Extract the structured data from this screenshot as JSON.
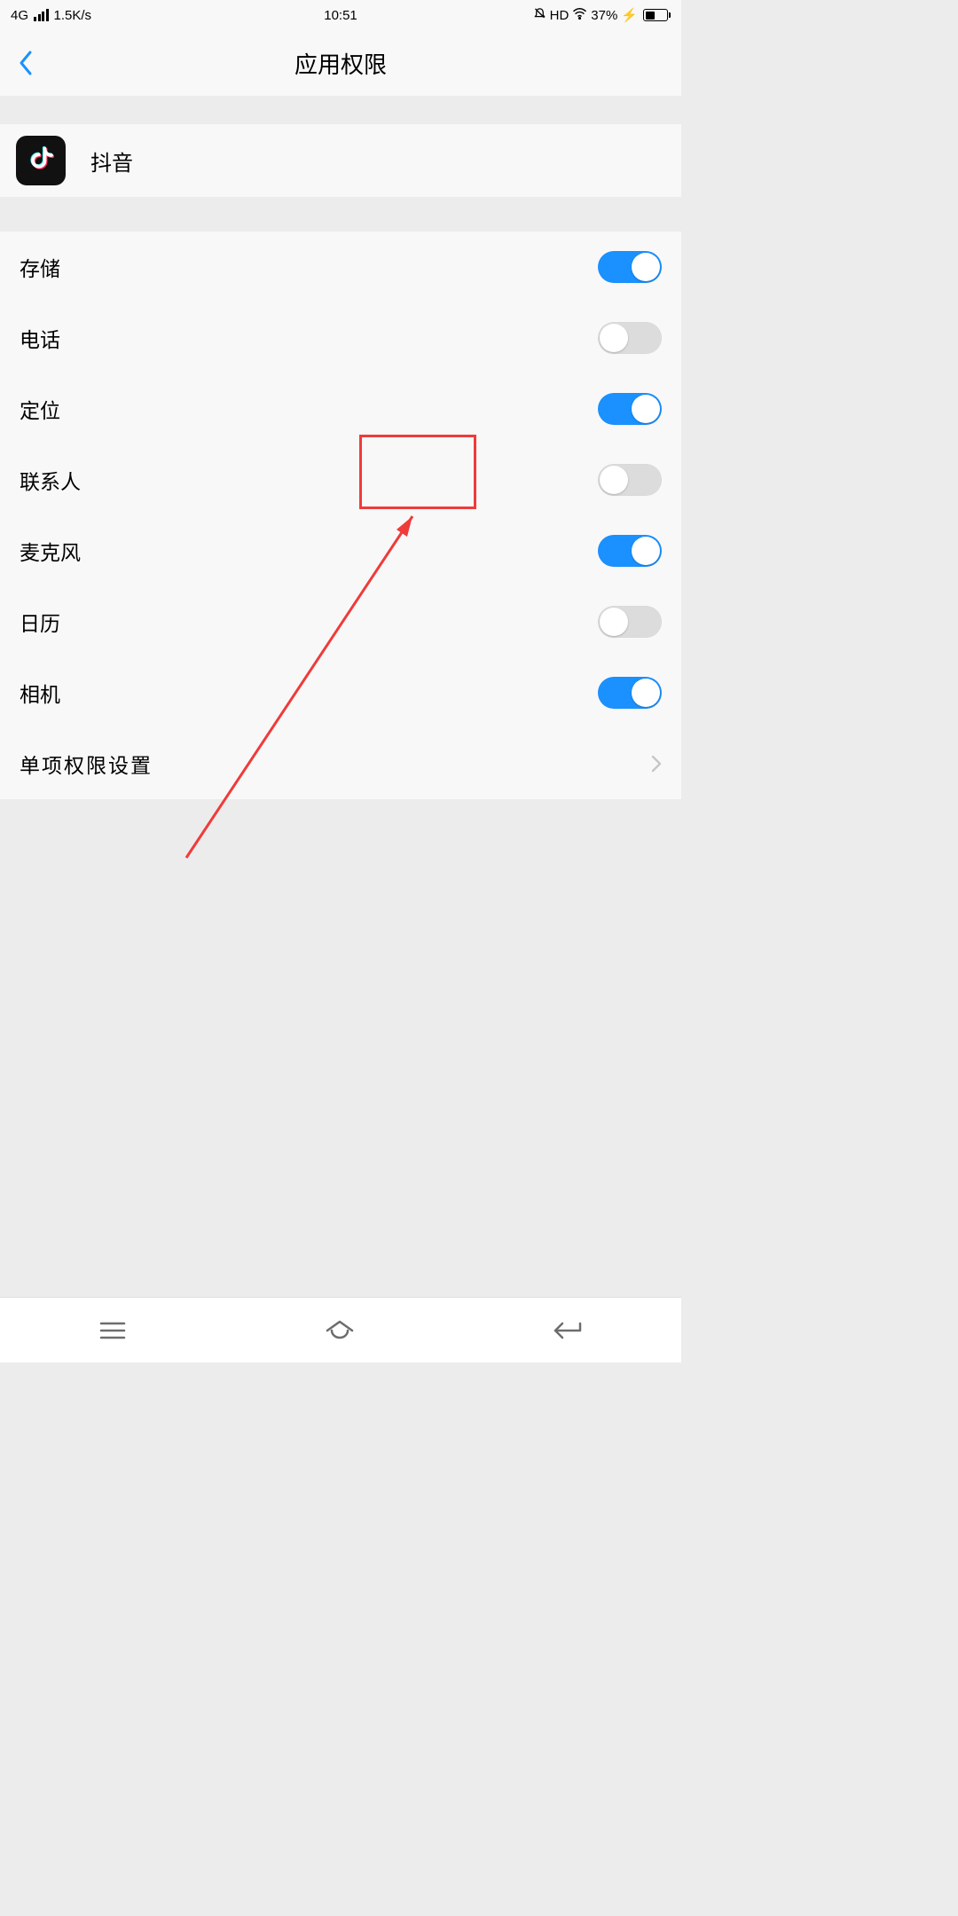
{
  "status": {
    "net": "4G",
    "speed": "1.5K/s",
    "time": "10:51",
    "hd": "HD",
    "battery_pct": "37%"
  },
  "header": {
    "title": "应用权限"
  },
  "app": {
    "name": "抖音"
  },
  "perms": [
    {
      "label": "存储",
      "on": true
    },
    {
      "label": "电话",
      "on": false
    },
    {
      "label": "定位",
      "on": true
    },
    {
      "label": "联系人",
      "on": false
    },
    {
      "label": "麦克风",
      "on": true
    },
    {
      "label": "日历",
      "on": false
    },
    {
      "label": "相机",
      "on": true
    }
  ],
  "more": {
    "label": "单项权限设置"
  },
  "annotation": {
    "highlight_row_index": 3
  }
}
